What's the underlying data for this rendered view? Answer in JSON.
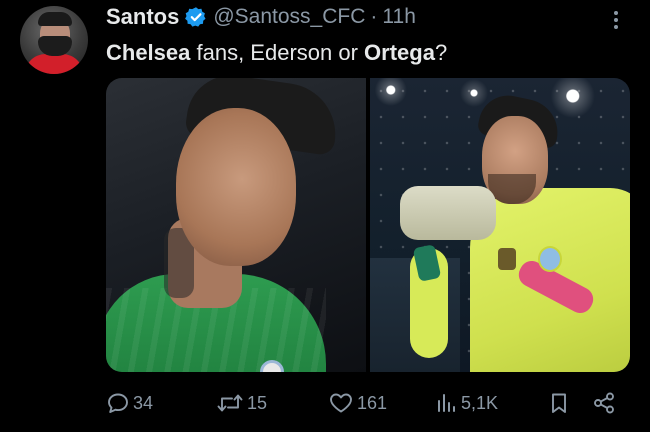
{
  "author": {
    "display_name": "Santos",
    "handle": "@Santoss_CFC",
    "separator": "·",
    "time": "11h",
    "verified_icon": "verified-badge-icon"
  },
  "tweet": {
    "text_parts": [
      {
        "text": "Chelsea",
        "bold": true
      },
      {
        "text": " fans, Ederson or ",
        "bold": false
      },
      {
        "text": "Ortega",
        "bold": true
      },
      {
        "text": "?",
        "bold": false
      }
    ]
  },
  "media": {
    "images": [
      {
        "alt": ""
      },
      {
        "alt": ""
      }
    ]
  },
  "actions": {
    "replies": "34",
    "retweets": "15",
    "likes": "161",
    "views": "5,1K"
  },
  "colors": {
    "background": "#000000",
    "text_primary": "#e7e9ea",
    "text_secondary": "#8b98a5",
    "verified_blue": "#1d9bf0"
  }
}
